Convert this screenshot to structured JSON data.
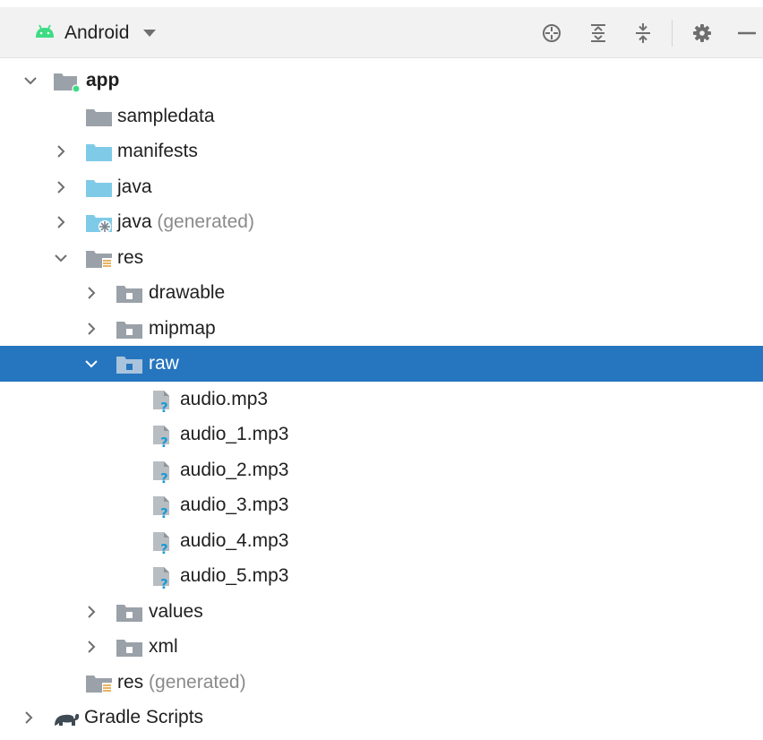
{
  "toolbar": {
    "view_label": "Android",
    "icons": [
      "android-icon",
      "dropdown-caret-icon",
      "locate-icon",
      "expand-all-icon",
      "collapse-all-icon",
      "gear-icon",
      "minimize-icon"
    ]
  },
  "colors": {
    "selection": "#2675bf",
    "folder_blue": "#7fcbe7",
    "folder_gray": "#9aa1a8",
    "android_green": "#3ddc84",
    "hint_gray": "#8a8a8a"
  },
  "tree": {
    "app": "app",
    "sampledata": "sampledata",
    "manifests": "manifests",
    "java": "java",
    "java_generated": "java",
    "java_generated_hint": "(generated)",
    "res": "res",
    "drawable": "drawable",
    "mipmap": "mipmap",
    "raw": "raw",
    "files": [
      "audio.mp3",
      "audio_1.mp3",
      "audio_2.mp3",
      "audio_3.mp3",
      "audio_4.mp3",
      "audio_5.mp3"
    ],
    "values": "values",
    "xml": "xml",
    "res_generated": "res",
    "res_generated_hint": "(generated)",
    "gradle_scripts": "Gradle Scripts"
  }
}
